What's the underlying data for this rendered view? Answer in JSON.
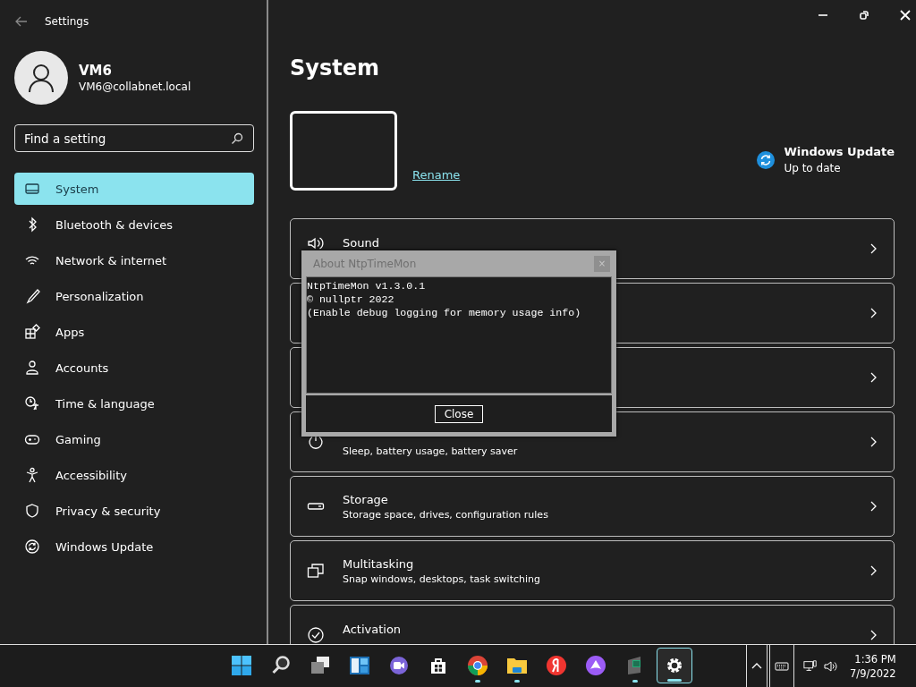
{
  "window": {
    "title": "Settings"
  },
  "account": {
    "name": "VM6",
    "email": "VM6@collabnet.local"
  },
  "search": {
    "placeholder": "Find a setting"
  },
  "sidebar": {
    "items": [
      {
        "kind": "system",
        "label": "System",
        "selected": true
      },
      {
        "kind": "bluetooth",
        "label": "Bluetooth & devices",
        "selected": false
      },
      {
        "kind": "network",
        "label": "Network & internet",
        "selected": false
      },
      {
        "kind": "brush",
        "label": "Personalization",
        "selected": false
      },
      {
        "kind": "apps",
        "label": "Apps",
        "selected": false
      },
      {
        "kind": "person",
        "label": "Accounts",
        "selected": false
      },
      {
        "kind": "time",
        "label": "Time & language",
        "selected": false
      },
      {
        "kind": "gaming",
        "label": "Gaming",
        "selected": false
      },
      {
        "kind": "accessibility",
        "label": "Accessibility",
        "selected": false
      },
      {
        "kind": "shield",
        "label": "Privacy & security",
        "selected": false
      },
      {
        "kind": "update",
        "label": "Windows Update",
        "selected": false
      }
    ]
  },
  "page": {
    "title": "System",
    "rename": "Rename",
    "update": {
      "title": "Windows Update",
      "status": "Up to date"
    }
  },
  "cards": [
    {
      "kind": "sound",
      "title": "Sound"
    },
    {
      "kind": "hidden"
    },
    {
      "kind": "hidden"
    },
    {
      "kind": "power",
      "subtitle": "Sleep, battery usage, battery saver"
    },
    {
      "kind": "storage",
      "title": "Storage",
      "subtitle": "Storage space, drives, configuration rules"
    },
    {
      "kind": "multitasking",
      "title": "Multitasking",
      "subtitle": "Snap windows, desktops, task switching"
    },
    {
      "kind": "activation",
      "title": "Activation"
    }
  ],
  "dialog": {
    "title": "About NtpTimeMon",
    "lines": [
      "NtpTimeMon v1.3.0.1",
      "© nullptr 2022",
      "(Enable debug logging for memory usage info)"
    ],
    "close": "×",
    "button": "Close"
  },
  "taskbar": {
    "apps": [
      {
        "kind": "start",
        "running": false,
        "selected": false
      },
      {
        "kind": "search",
        "running": false,
        "selected": false
      },
      {
        "kind": "taskview",
        "running": false,
        "selected": false
      },
      {
        "kind": "widgets",
        "running": false,
        "selected": false
      },
      {
        "kind": "chat",
        "running": false,
        "selected": false
      },
      {
        "kind": "store",
        "running": false,
        "selected": false
      },
      {
        "kind": "chrome",
        "running": true,
        "selected": false
      },
      {
        "kind": "explorer",
        "running": true,
        "selected": false
      },
      {
        "kind": "yandex",
        "running": false,
        "selected": false
      },
      {
        "kind": "alice",
        "running": false,
        "selected": false
      },
      {
        "kind": "app",
        "running": true,
        "selected": false
      },
      {
        "kind": "settings",
        "running": true,
        "selected": true
      }
    ],
    "clock": {
      "time": "1:36 PM",
      "date": "7/9/2022"
    }
  }
}
